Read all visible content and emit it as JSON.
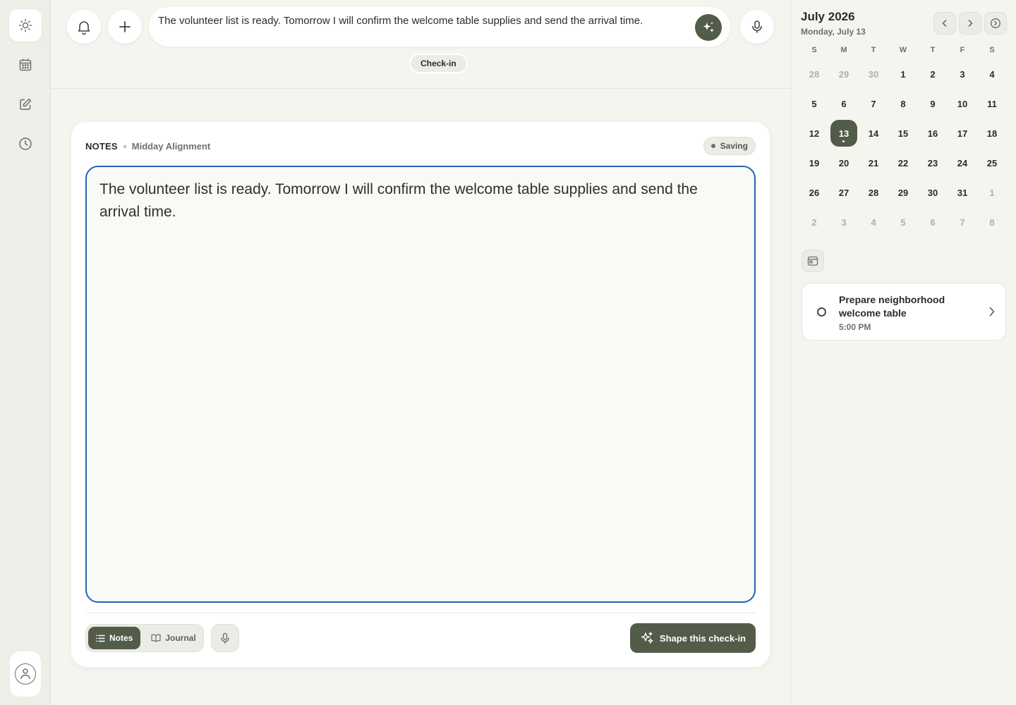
{
  "colors": {
    "accent": "#535b49",
    "focus_border": "#2463b0",
    "background": "#f5f5f0"
  },
  "rail": {
    "items": [
      {
        "icon": "sun-icon",
        "active": true
      },
      {
        "icon": "calendar-icon",
        "active": false
      },
      {
        "icon": "edit-icon",
        "active": false
      },
      {
        "icon": "clock-icon",
        "active": false
      }
    ],
    "profile_icon": "person-icon"
  },
  "top": {
    "notification_icon": "bell-icon",
    "add_icon": "plus-icon",
    "prompt_text": "The volunteer list is ready. Tomorrow I will confirm the welcome table supplies and send the arrival time.",
    "submit_icon": "sparkle-icon",
    "mic_icon": "microphone-icon",
    "chip_label": "Check-in"
  },
  "card": {
    "section_label": "NOTES",
    "subtitle": "Midday Alignment",
    "status": "Saving",
    "editor_text": "The volunteer list is ready. Tomorrow I will confirm the welcome table supplies and send the arrival time.",
    "mode_notes": "Notes",
    "mode_journal": "Journal",
    "active_mode": "Notes",
    "shape_button": "Shape this check-in"
  },
  "calendar": {
    "month_title": "July 2026",
    "selected_label": "Monday, July 13",
    "weekday_headers": [
      "S",
      "M",
      "T",
      "W",
      "T",
      "F",
      "S"
    ],
    "weeks": [
      [
        {
          "d": "28",
          "m": true
        },
        {
          "d": "29",
          "m": true
        },
        {
          "d": "30",
          "m": true
        },
        {
          "d": "1"
        },
        {
          "d": "2"
        },
        {
          "d": "3"
        },
        {
          "d": "4"
        }
      ],
      [
        {
          "d": "5"
        },
        {
          "d": "6"
        },
        {
          "d": "7"
        },
        {
          "d": "8"
        },
        {
          "d": "9"
        },
        {
          "d": "10"
        },
        {
          "d": "11"
        }
      ],
      [
        {
          "d": "12"
        },
        {
          "d": "13",
          "sel": true
        },
        {
          "d": "14"
        },
        {
          "d": "15"
        },
        {
          "d": "16"
        },
        {
          "d": "17"
        },
        {
          "d": "18"
        }
      ],
      [
        {
          "d": "19"
        },
        {
          "d": "20"
        },
        {
          "d": "21"
        },
        {
          "d": "22"
        },
        {
          "d": "23"
        },
        {
          "d": "24"
        },
        {
          "d": "25"
        }
      ],
      [
        {
          "d": "26"
        },
        {
          "d": "27"
        },
        {
          "d": "28"
        },
        {
          "d": "29"
        },
        {
          "d": "30"
        },
        {
          "d": "31"
        },
        {
          "d": "1",
          "m": true
        }
      ],
      [
        {
          "d": "2",
          "m": true
        },
        {
          "d": "3",
          "m": true
        },
        {
          "d": "4",
          "m": true
        },
        {
          "d": "5",
          "m": true
        },
        {
          "d": "6",
          "m": true
        },
        {
          "d": "7",
          "m": true
        },
        {
          "d": "8",
          "m": true
        }
      ]
    ]
  },
  "tasks": [
    {
      "title": "Prepare neighborhood welcome table",
      "time": "5:00 PM"
    }
  ]
}
